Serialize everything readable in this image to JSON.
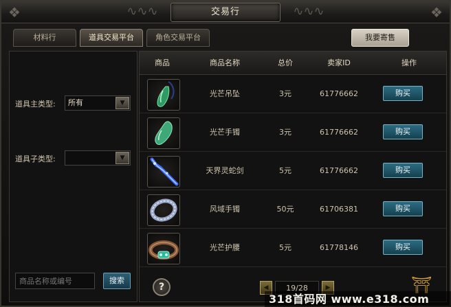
{
  "window": {
    "title": "交易行"
  },
  "tabs": [
    {
      "label": "材料行",
      "active": false
    },
    {
      "label": "道具交易平台",
      "active": true
    },
    {
      "label": "角色交易平台",
      "active": false
    }
  ],
  "sell_button": "我要寄售",
  "filters": {
    "main_type_label": "道具主类型:",
    "main_type_value": "所有",
    "sub_type_label": "道具子类型:",
    "sub_type_value": ""
  },
  "search": {
    "placeholder": "商品名称或编号",
    "button": "搜索"
  },
  "table": {
    "columns": [
      "商品",
      "商品名称",
      "总价",
      "卖家ID",
      "操作"
    ],
    "rows": [
      {
        "icon": "green-pendant-icon",
        "name": "光芒吊坠",
        "price": "3元",
        "seller": "61776662",
        "action": "购买"
      },
      {
        "icon": "jade-bracelet-icon",
        "name": "光芒手镯",
        "price": "3元",
        "seller": "61776662",
        "action": "购买"
      },
      {
        "icon": "blue-snake-sword-icon",
        "name": "天界灵蛇剑",
        "price": "5元",
        "seller": "61776662",
        "action": "购买"
      },
      {
        "icon": "silver-bracelet-icon",
        "name": "风域手镯",
        "price": "50元",
        "seller": "61706381",
        "action": "购买"
      },
      {
        "icon": "jade-belt-icon",
        "name": "光芒护腰",
        "price": "5元",
        "seller": "61778146",
        "action": "购买"
      }
    ]
  },
  "pagination": {
    "text": "19/28"
  },
  "help": "?",
  "watermark": "318首码网 www.e318.com",
  "colors": {
    "buy_button": "#2c6b82",
    "sell_button": "#d8d2c4",
    "gold": "#c89b35"
  }
}
